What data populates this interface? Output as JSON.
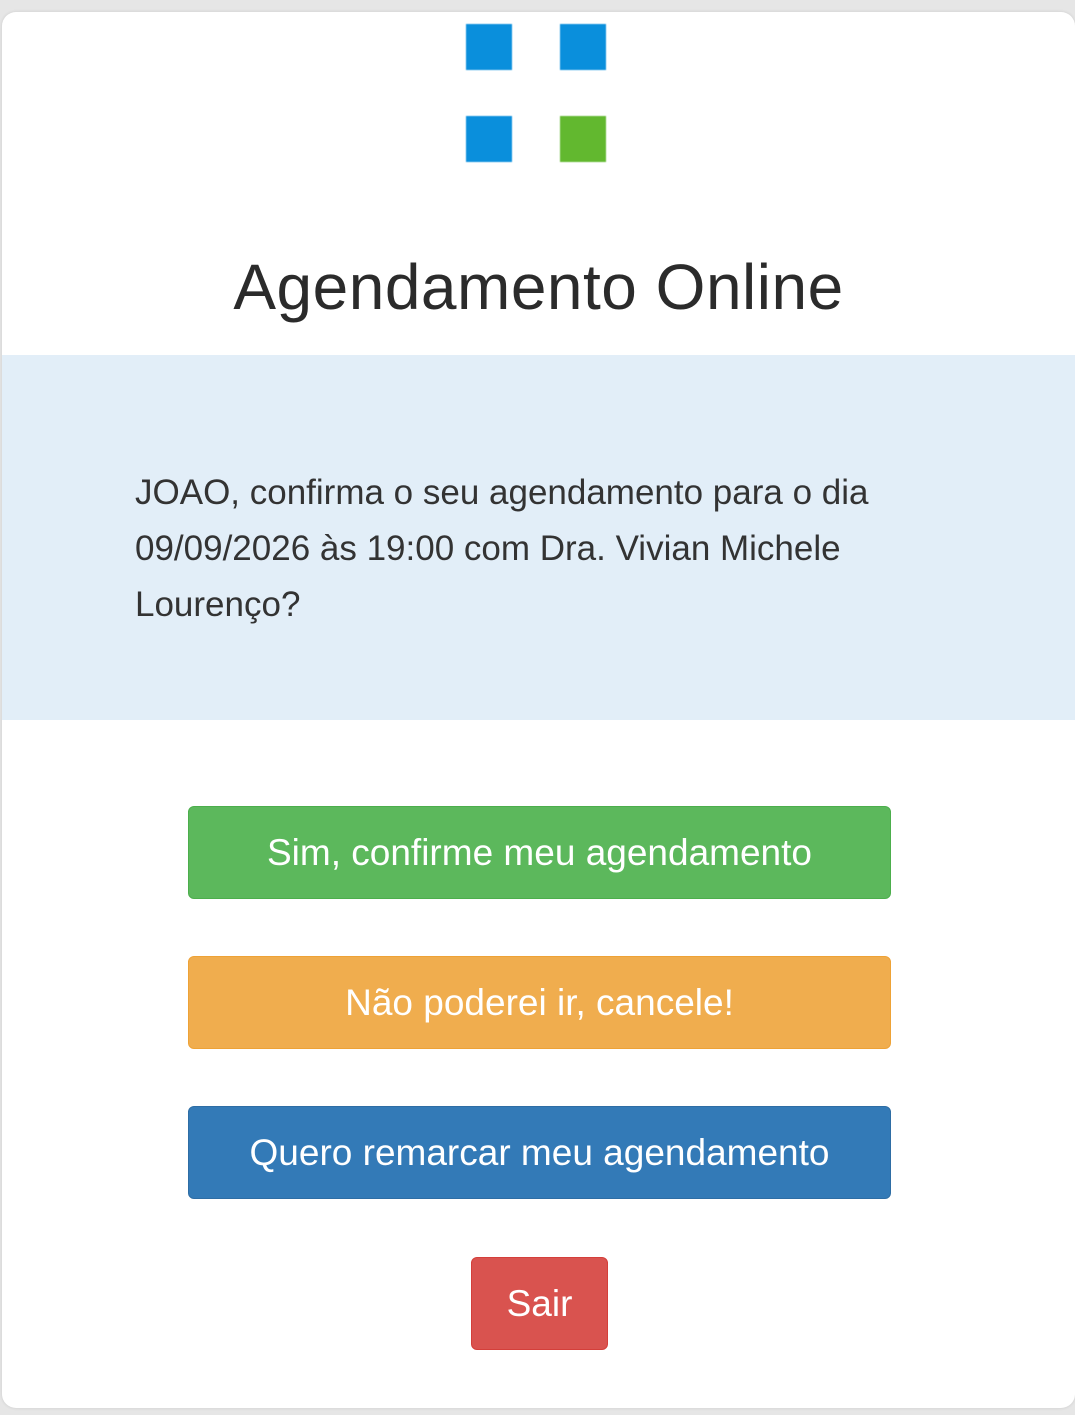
{
  "colors": {
    "logo_blue": "#0a8fdc",
    "logo_green": "#62b82f",
    "panel_bg": "#e2eef8",
    "success": "#5cb85c",
    "warning": "#f0ad4e",
    "primary": "#337ab7",
    "danger": "#d9534f"
  },
  "header": {
    "logo_icon": "clinic-logo-icon",
    "title": "Agendamento Online"
  },
  "message": {
    "text": "JOAO, confirma o seu agendamento para o dia 09/09/2026 às 19:00 com Dra. Vivian Michele Lourenço?"
  },
  "actions": {
    "confirm_label": "Sim, confirme meu agendamento",
    "cancel_label": "Não poderei ir, cancele!",
    "reschedule_label": "Quero remarcar meu agendamento",
    "exit_label": "Sair"
  }
}
